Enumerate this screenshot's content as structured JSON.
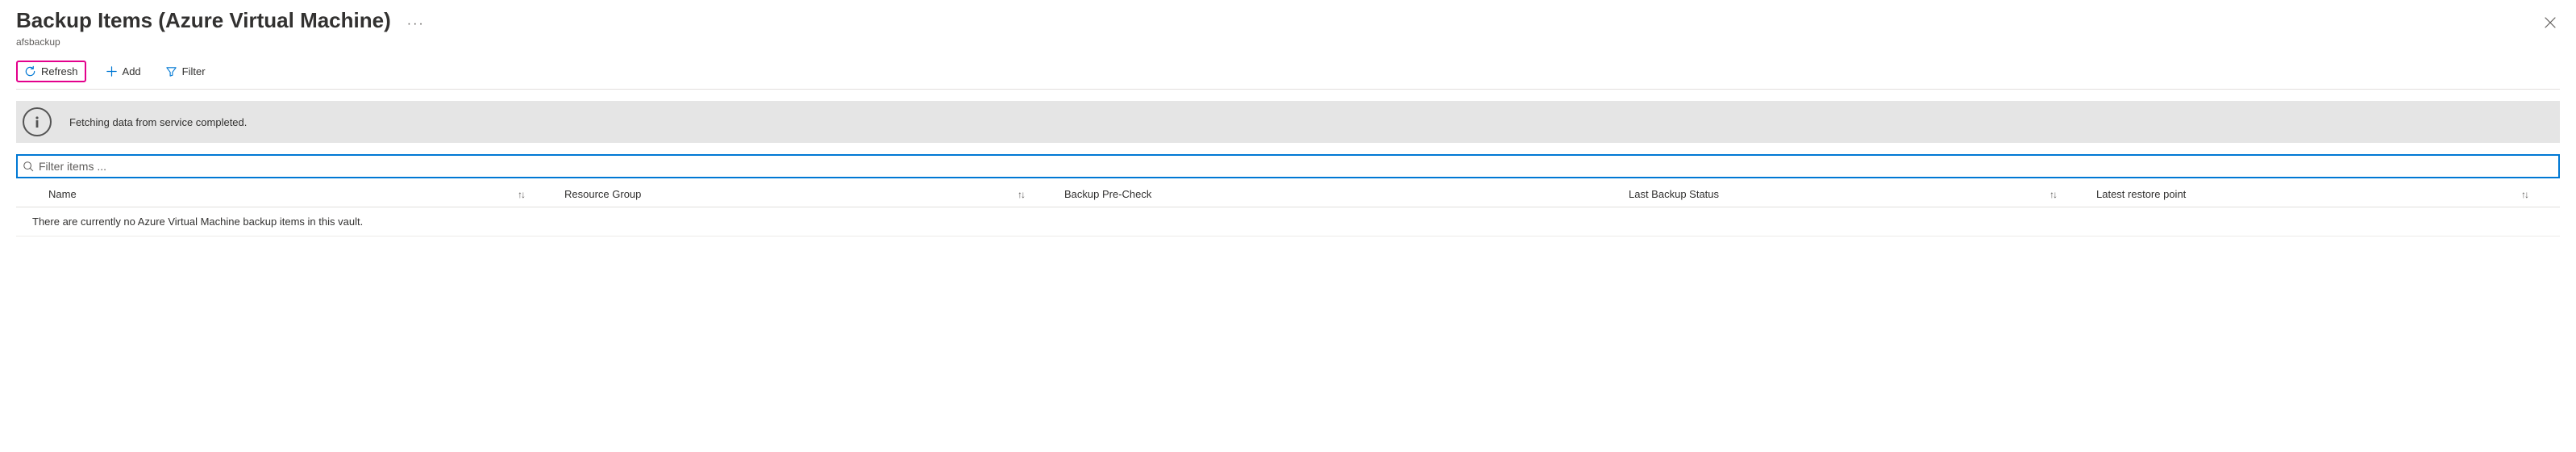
{
  "header": {
    "title": "Backup Items (Azure Virtual Machine)",
    "more": "···",
    "subtitle": "afsbackup"
  },
  "toolbar": {
    "refresh": "Refresh",
    "add": "Add",
    "filter": "Filter"
  },
  "banner": {
    "message": "Fetching data from service completed."
  },
  "filterInput": {
    "placeholder": "Filter items ...",
    "value": ""
  },
  "columns": {
    "name": "Name",
    "resourceGroup": "Resource Group",
    "preCheck": "Backup Pre-Check",
    "lastStatus": "Last Backup Status",
    "restorePoint": "Latest restore point"
  },
  "emptyState": "There are currently no Azure Virtual Machine backup items in this vault."
}
